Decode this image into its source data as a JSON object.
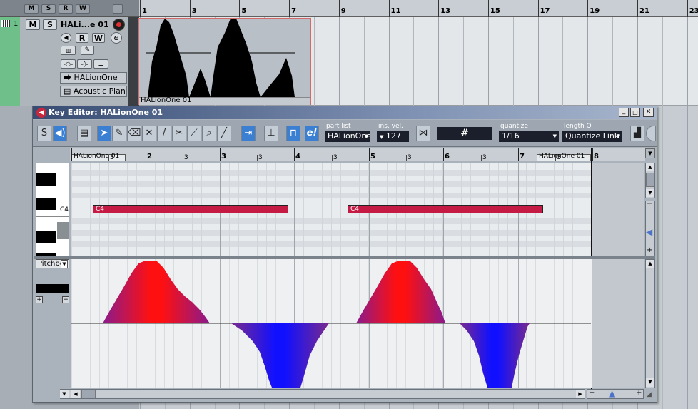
{
  "project": {
    "ruler_bars": [
      "1",
      "3",
      "5",
      "7",
      "9",
      "11",
      "13",
      "15",
      "17",
      "19",
      "21",
      "23"
    ],
    "track_number": "1",
    "track_mute": "M",
    "track_solo": "S",
    "track_name": "HALi...e 01",
    "read_btn": "R",
    "write_btn": "W",
    "edit_btn": "e",
    "output": "HALionOne",
    "program": "Acoustic Piano",
    "part_name": "HALionOne 01",
    "header_buttons": [
      "M",
      "S",
      "R",
      "W"
    ]
  },
  "editor": {
    "title": "Key Editor: HALionOne 01",
    "part_list_label": "part list",
    "part_list_value": "HALionOne",
    "ins_vel_label": "ins. vel.",
    "ins_vel_value": "127",
    "quantize_label": "quantize",
    "quantize_value": "1/16",
    "length_label": "length Q",
    "length_value": "Quantize Link",
    "snap_symbol": "#",
    "ruler_part_start": "HALionOne 01",
    "ruler_part_end": "HALionOne 01",
    "ruler_major": [
      "2",
      "3",
      "4",
      "5",
      "6",
      "7",
      "8"
    ],
    "ruler_minor": [
      "3",
      "3",
      "3",
      "3",
      "3",
      "3",
      "3"
    ],
    "key_label": "C4",
    "notes": [
      "C4",
      "C4"
    ],
    "controller": "Pitchbe",
    "plus": "+",
    "minus": "−",
    "accent": "#c41a44",
    "pitchbend_up": "#ff1010",
    "pitchbend_down": "#1010ff"
  }
}
